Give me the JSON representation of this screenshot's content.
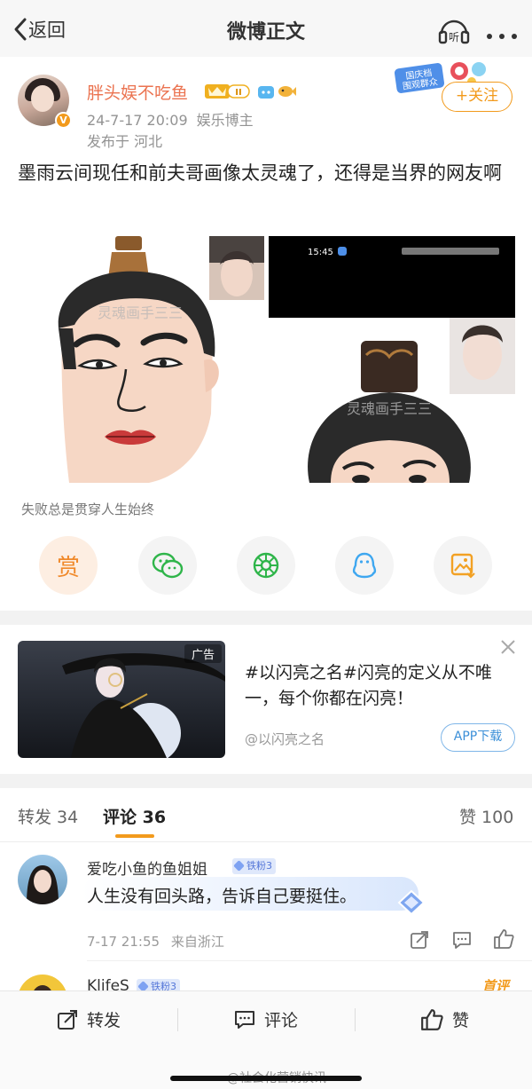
{
  "nav": {
    "back_label": "返回",
    "title": "微博正文",
    "listen_label": "听"
  },
  "author": {
    "name": "胖头娱不吃鱼",
    "level_badge": "II",
    "verified_mark": "V",
    "date": "24-7-17 20:09",
    "role": "娱乐博主",
    "location": "发布于 河北",
    "follow_label": "+关注",
    "event_badge": "国庆档 围观群众"
  },
  "post": {
    "text": "墨雨云间现任和前夫哥画像太灵魂了，还得是当界的网友啊",
    "image1_watermark": "灵魂画手三三",
    "image2_watermark": "灵魂画手三三",
    "image2_status_time": "15:45",
    "image_caption": "失败总是贯穿人生始终"
  },
  "share": {
    "reward_label": "赏",
    "items": [
      "reward",
      "wechat",
      "moments",
      "qq",
      "save-image"
    ]
  },
  "ad": {
    "label": "广告",
    "text": "#以闪亮之名#闪亮的定义从不唯一，每个你都在闪亮！",
    "source": "@以闪亮之名",
    "button": "APP下载"
  },
  "tabs": {
    "repost": "转发 34",
    "comment": "评论 36",
    "like": "赞 100"
  },
  "comments": [
    {
      "name": "爱吃小鱼的鱼姐姐",
      "badge": "铁粉3",
      "text": "人生没有回头路，告诉自己要挺住。",
      "time": "7-17 21:55",
      "location": "来自浙江"
    },
    {
      "name": "KlifeS",
      "badge": "铁粉3",
      "hot": "首评"
    }
  ],
  "bottombar": {
    "repost": "转发",
    "comment": "评论",
    "like": "赞"
  },
  "watermark": "@社会化营销快讯",
  "colors": {
    "accent_orange": "#f29a1c",
    "author_name": "#eb7350",
    "meta_gray": "#939393",
    "link_blue": "#3b8fd8"
  }
}
